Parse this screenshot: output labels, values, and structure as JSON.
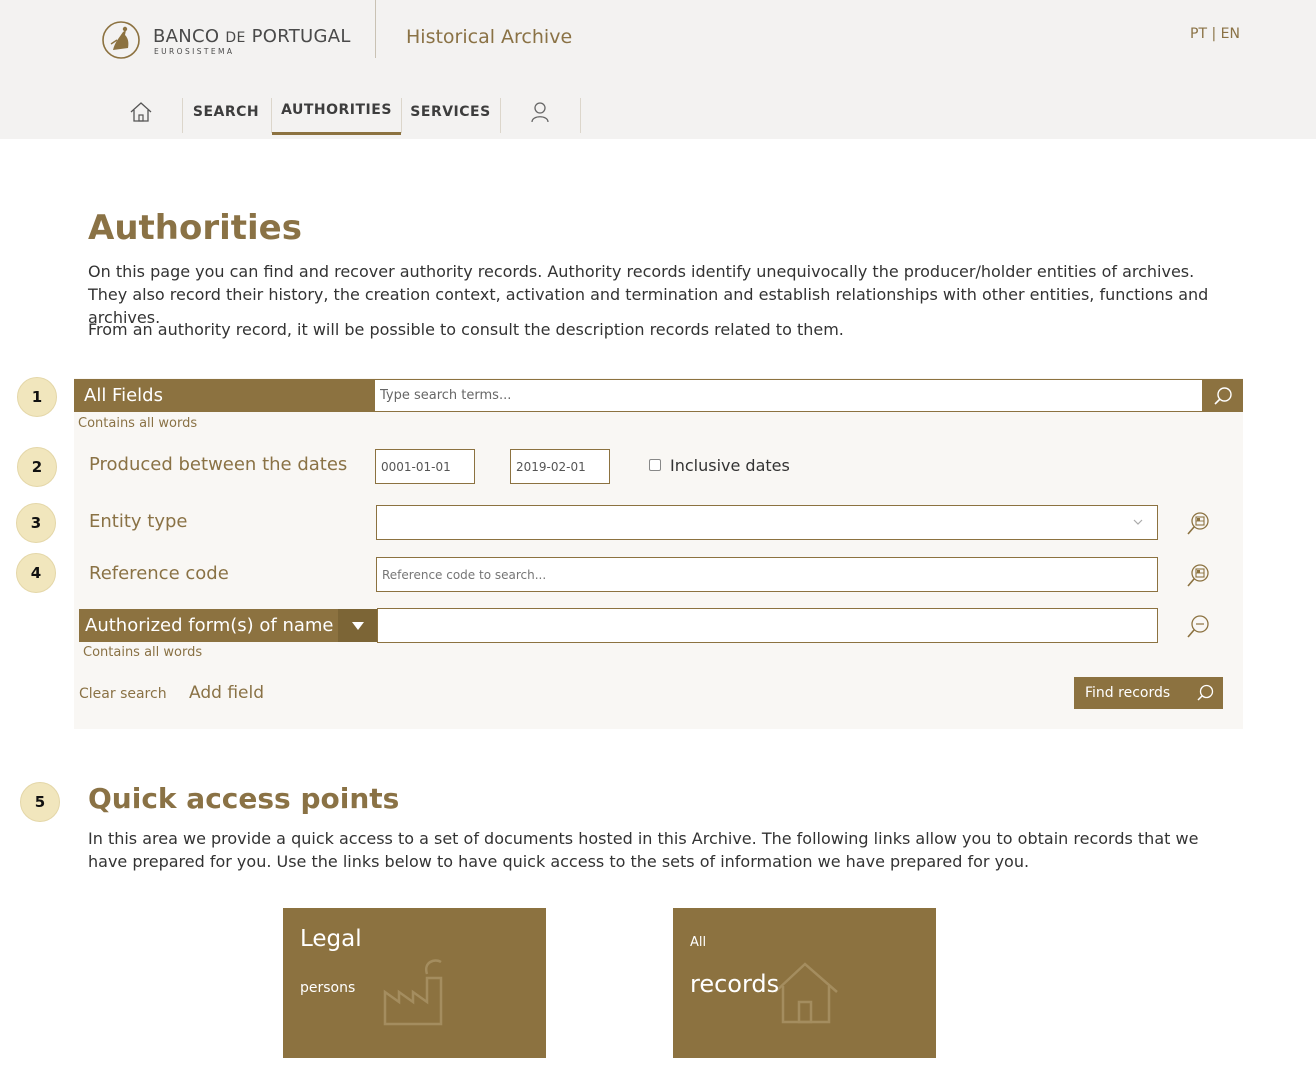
{
  "header": {
    "logo_name_1": "BANCO ",
    "logo_name_de": "DE",
    "logo_name_2": " PORTUGAL",
    "logo_sub": "EUROSISTEMA",
    "site_title": "Historical Archive",
    "lang_pt": "PT",
    "lang_sep": " | ",
    "lang_en": "EN"
  },
  "nav": {
    "home_icon": "home-icon",
    "search": "SEARCH",
    "authorities": "AUTHORITIES",
    "services": "SERVICES",
    "user_icon": "user-icon",
    "active": "AUTHORITIES"
  },
  "intro": {
    "title": "Authorities",
    "paragraph1": "On this page you can find and recover authority records. Authority records identify unequivocally the producer/holder entities of archives. They also record their history, the creation context, activation and termination and establish relationships with other entities, functions and archives.",
    "paragraph2": "From an authority record, it will be possible to consult the description records related to them."
  },
  "badges": [
    "1",
    "2",
    "3",
    "4",
    "5"
  ],
  "search": {
    "all_fields_label": "All Fields",
    "all_fields_placeholder": "Type search terms...",
    "all_fields_hint": "Contains all words",
    "dates_label": "Produced between the dates",
    "date_from": "0001-01-01",
    "date_to": "2019-02-01",
    "inclusive_label": "Inclusive dates",
    "inclusive_checked": false,
    "entity_type_label": "Entity type",
    "entity_type_value": "",
    "reference_label": "Reference code",
    "reference_placeholder": "Reference code to search...",
    "authorized_label": "Authorized form(s) of name",
    "authorized_value": "",
    "authorized_hint": "Contains all words",
    "clear_label": "Clear search",
    "add_field_label": "Add field",
    "find_label": "Find records"
  },
  "quick_access": {
    "title": "Quick access points",
    "text": "In this area we provide a quick access to a set of documents hosted in this Archive. The following links allow you to obtain records that we have prepared for you. Use the links below to have quick access to the sets of information we have prepared for you.",
    "tiles": [
      {
        "big": "Legal",
        "small": "persons",
        "icon": "factory-icon"
      },
      {
        "small": "All",
        "big": "records",
        "icon": "house-icon"
      }
    ]
  },
  "colors": {
    "brand": "#8c7240",
    "brand_text": "#8a7245",
    "header_bg": "#f3f2f1",
    "panel_bg": "#f9f7f4",
    "badge_bg": "#f1e6bd"
  }
}
